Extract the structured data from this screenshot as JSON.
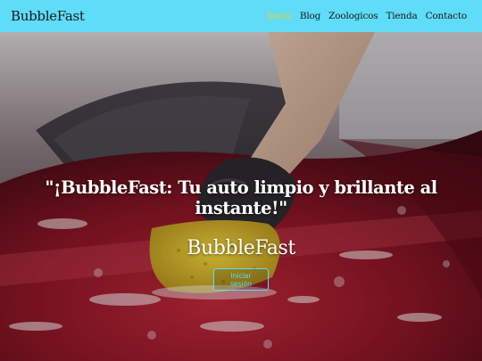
{
  "navbar": {
    "brand": "BubbleFast",
    "links": [
      "Inicio",
      "Blog",
      "Zoologicos",
      "Tienda",
      "Contacto"
    ],
    "active_link": "Inicio"
  },
  "hero": {
    "title": "\"¡BubbleFast: Tu auto limpio y brillante al instante!\"",
    "brand": "BubbleFast",
    "login_button": "Iniciar sesión"
  },
  "colors": {
    "navbar_bg": "#5fdcf7",
    "active_link": "#e8d32a",
    "button_border": "#5fdcf7",
    "car_red": "#a81b2c"
  }
}
